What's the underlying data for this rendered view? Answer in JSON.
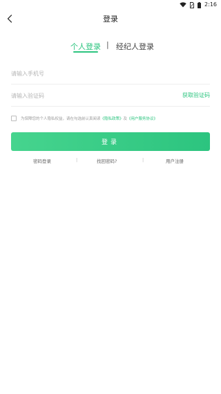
{
  "status_bar": {
    "time": "2:16",
    "icons": [
      "wifi-icon",
      "sim-icon",
      "battery-icon"
    ]
  },
  "nav": {
    "back_icon": "chevron-left-icon",
    "title": "登录"
  },
  "tabs": {
    "personal": "个人登录",
    "divider": "|",
    "agent": "经纪人登录",
    "active": "personal"
  },
  "form": {
    "phone_placeholder": "请输入手机号",
    "code_placeholder": "请输入验证码",
    "get_code": "获取验证码",
    "agreement_text_1": "为保障您的个人隐私权益，请在勾选前认真阅读",
    "privacy_link": "《隐私政策》",
    "agreement_and": "及",
    "service_link": "《用户服务协议》",
    "login_button": "登录"
  },
  "links": {
    "password_login": "密码登录",
    "separator": "|",
    "find_password": "找回密码?",
    "register": "用户注册"
  },
  "colors": {
    "accent": "#2cc47f",
    "button_gradient_start": "#46d48e",
    "placeholder": "#b5b5b5"
  }
}
